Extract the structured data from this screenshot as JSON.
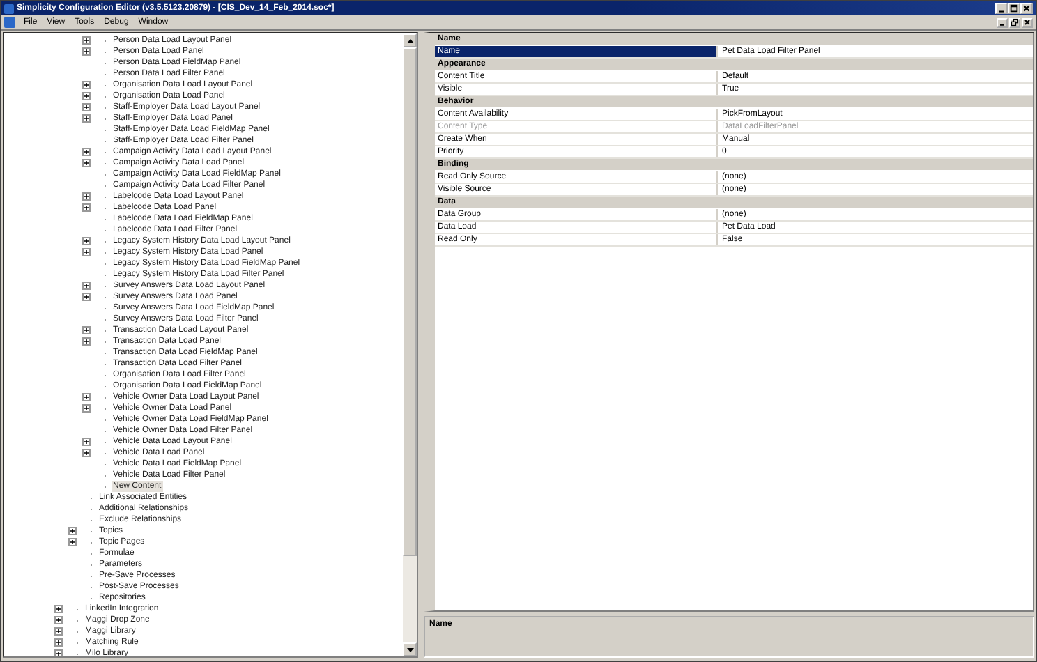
{
  "window": {
    "title": "Simplicity Configuration Editor (v3.5.5123.20879) - [CIS_Dev_14_Feb_2014.soc*]"
  },
  "menu": [
    {
      "label": "File"
    },
    {
      "label": "View"
    },
    {
      "label": "Tools"
    },
    {
      "label": "Debug"
    },
    {
      "label": "Window"
    }
  ],
  "tree": {
    "items": [
      {
        "children": [
          {
            "children": [
              {
                "label": "Person Data Load Layout Panel",
                "expandable": true,
                "selected": false
              },
              {
                "label": "Person Data Load Panel",
                "expandable": true,
                "selected": false
              },
              {
                "label": "Person Data Load FieldMap Panel",
                "expandable": false,
                "selected": false
              },
              {
                "label": "Person Data Load Filter Panel",
                "expandable": false,
                "selected": false
              },
              {
                "label": "Organisation Data Load Layout Panel",
                "expandable": true,
                "selected": false
              },
              {
                "label": "Organisation Data Load Panel",
                "expandable": true,
                "selected": false
              },
              {
                "label": "Staff-Employer Data Load Layout Panel",
                "expandable": true,
                "selected": false
              },
              {
                "label": "Staff-Employer Data Load Panel",
                "expandable": true,
                "selected": false
              },
              {
                "label": "Staff-Employer Data Load FieldMap Panel",
                "expandable": false,
                "selected": false
              },
              {
                "label": "Staff-Employer Data Load Filter Panel",
                "expandable": false,
                "selected": false
              },
              {
                "label": "Campaign Activity Data Load Layout Panel",
                "expandable": true,
                "selected": false
              },
              {
                "label": "Campaign Activity Data Load Panel",
                "expandable": true,
                "selected": false
              },
              {
                "label": "Campaign Activity Data Load FieldMap Panel",
                "expandable": false,
                "selected": false
              },
              {
                "label": "Campaign Activity Data Load Filter Panel",
                "expandable": false,
                "selected": false
              },
              {
                "label": "Labelcode Data Load Layout Panel",
                "expandable": true,
                "selected": false
              },
              {
                "label": "Labelcode Data Load Panel",
                "expandable": true,
                "selected": false
              },
              {
                "label": "Labelcode Data Load FieldMap Panel",
                "expandable": false,
                "selected": false
              },
              {
                "label": "Labelcode Data Load Filter Panel",
                "expandable": false,
                "selected": false
              },
              {
                "label": "Legacy System History Data Load Layout Panel",
                "expandable": true,
                "selected": false
              },
              {
                "label": "Legacy System History Data Load Panel",
                "expandable": true,
                "selected": false
              },
              {
                "label": "Legacy System History Data Load FieldMap Panel",
                "expandable": false,
                "selected": false
              },
              {
                "label": "Legacy System History Data Load Filter Panel",
                "expandable": false,
                "selected": false
              },
              {
                "label": "Survey Answers Data Load Layout Panel",
                "expandable": true,
                "selected": false
              },
              {
                "label": "Survey Answers Data Load Panel",
                "expandable": true,
                "selected": false
              },
              {
                "label": "Survey Answers Data Load FieldMap Panel",
                "expandable": false,
                "selected": false
              },
              {
                "label": "Survey Answers Data Load Filter Panel",
                "expandable": false,
                "selected": false
              },
              {
                "label": "Transaction Data Load Layout Panel",
                "expandable": true,
                "selected": false
              },
              {
                "label": "Transaction Data Load Panel",
                "expandable": true,
                "selected": false
              },
              {
                "label": "Transaction Data Load FieldMap Panel",
                "expandable": false,
                "selected": false
              },
              {
                "label": "Transaction Data Load Filter Panel",
                "expandable": false,
                "selected": false
              },
              {
                "label": "Organisation Data Load Filter Panel",
                "expandable": false,
                "selected": false
              },
              {
                "label": "Organisation Data Load FieldMap Panel",
                "expandable": false,
                "selected": false
              },
              {
                "label": "Vehicle Owner Data Load Layout Panel",
                "expandable": true,
                "selected": false
              },
              {
                "label": "Vehicle Owner Data Load Panel",
                "expandable": true,
                "selected": false
              },
              {
                "label": "Vehicle Owner Data Load FieldMap Panel",
                "expandable": false,
                "selected": false
              },
              {
                "label": "Vehicle Owner Data Load Filter Panel",
                "expandable": false,
                "selected": false
              },
              {
                "label": "Vehicle Data Load Layout Panel",
                "expandable": true,
                "selected": false
              },
              {
                "label": "Vehicle Data Load Panel",
                "expandable": true,
                "selected": false
              },
              {
                "label": "Vehicle Data Load FieldMap Panel",
                "expandable": false,
                "selected": false
              },
              {
                "label": "Vehicle Data Load Filter Panel",
                "expandable": false,
                "selected": false
              },
              {
                "label": "New Content",
                "expandable": false,
                "selected": true
              }
            ]
          },
          {
            "label": "Link Associated Entities",
            "expandable": false,
            "selected": false
          },
          {
            "label": "Additional Relationships",
            "expandable": false,
            "selected": false
          },
          {
            "label": "Exclude Relationships",
            "expandable": false,
            "selected": false
          },
          {
            "label": "Topics",
            "expandable": true,
            "selected": false
          },
          {
            "label": "Topic Pages",
            "expandable": true,
            "selected": false
          },
          {
            "label": "Formulae",
            "expandable": false,
            "selected": false
          },
          {
            "label": "Parameters",
            "expandable": false,
            "selected": false
          },
          {
            "label": "Pre-Save Processes",
            "expandable": false,
            "selected": false
          },
          {
            "label": "Post-Save Processes",
            "expandable": false,
            "selected": false
          },
          {
            "label": "Repositories",
            "expandable": false,
            "selected": false
          }
        ]
      },
      {
        "label": "LinkedIn Integration",
        "expandable": true,
        "selected": false
      },
      {
        "label": "Maggi Drop Zone",
        "expandable": true,
        "selected": false
      },
      {
        "label": "Maggi Library",
        "expandable": true,
        "selected": false
      },
      {
        "label": "Matching Rule",
        "expandable": true,
        "selected": false
      },
      {
        "label": "Milo Library",
        "expandable": true,
        "selected": false
      }
    ]
  },
  "properties": {
    "categories": [
      {
        "name": "Name",
        "expanded": true,
        "rows": [
          {
            "label": "Name",
            "value": "Pet Data Load Filter Panel",
            "selected": true,
            "disabled": false
          }
        ]
      },
      {
        "name": "Appearance",
        "expanded": true,
        "rows": [
          {
            "label": "Content Title",
            "value": "Default",
            "selected": false,
            "disabled": false
          },
          {
            "label": "Visible",
            "value": "True",
            "selected": false,
            "disabled": false
          }
        ]
      },
      {
        "name": "Behavior",
        "expanded": true,
        "rows": [
          {
            "label": "Content Availability",
            "value": "PickFromLayout",
            "selected": false,
            "disabled": false
          },
          {
            "label": "Content Type",
            "value": "DataLoadFilterPanel",
            "selected": false,
            "disabled": true
          },
          {
            "label": "Create When",
            "value": "Manual",
            "selected": false,
            "disabled": false
          },
          {
            "label": "Priority",
            "value": "0",
            "selected": false,
            "disabled": false
          }
        ]
      },
      {
        "name": "Binding",
        "expanded": true,
        "rows": [
          {
            "label": "Read Only Source",
            "value": "(none)",
            "selected": false,
            "disabled": false
          },
          {
            "label": "Visible Source",
            "value": "(none)",
            "selected": false,
            "disabled": false
          }
        ]
      },
      {
        "name": "Data",
        "expanded": true,
        "rows": [
          {
            "label": "Data Group",
            "value": "(none)",
            "selected": false,
            "disabled": false
          },
          {
            "label": "Data Load",
            "value": "Pet Data Load",
            "selected": false,
            "disabled": false
          },
          {
            "label": "Read Only",
            "value": "False",
            "selected": false,
            "disabled": false
          }
        ]
      }
    ]
  },
  "description": {
    "title": "Name"
  }
}
